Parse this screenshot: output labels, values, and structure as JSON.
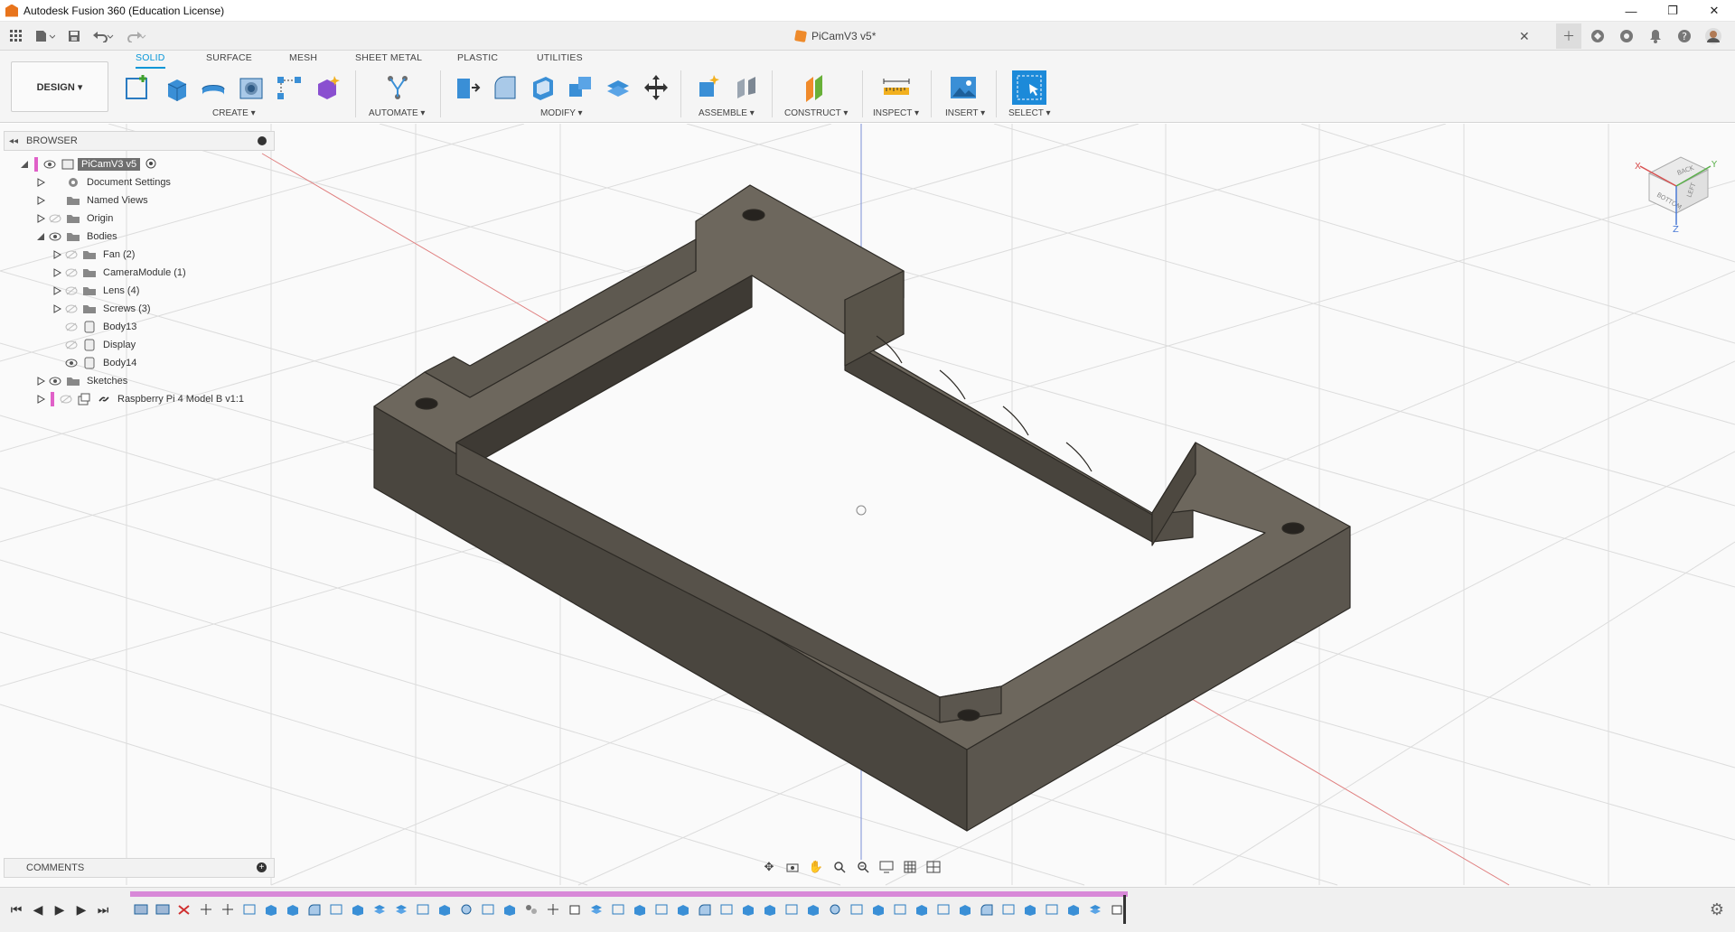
{
  "window": {
    "title": "Autodesk Fusion 360 (Education License)",
    "controls": [
      "—",
      "❐",
      "✕"
    ]
  },
  "tabrow": {
    "doc_title": "PiCamV3 v5*",
    "close": "✕"
  },
  "ribbon": {
    "workspace": "DESIGN ▾",
    "tabs": [
      "SOLID",
      "SURFACE",
      "MESH",
      "SHEET METAL",
      "PLASTIC",
      "UTILITIES"
    ],
    "groups": {
      "create": "CREATE ▾",
      "automate": "AUTOMATE ▾",
      "modify": "MODIFY ▾",
      "assemble": "ASSEMBLE ▾",
      "construct": "CONSTRUCT ▾",
      "inspect": "INSPECT ▾",
      "insert": "INSERT ▾",
      "select": "SELECT ▾"
    }
  },
  "browser": {
    "title": "BROWSER",
    "root": "PiCamV3 v5",
    "items": [
      {
        "label": "Document Settings",
        "icon": "gear-icon"
      },
      {
        "label": "Named Views",
        "icon": "folder-icon"
      },
      {
        "label": "Origin",
        "icon": "folder-icon"
      },
      {
        "label": "Bodies",
        "icon": "folder-icon"
      },
      {
        "label": "Fan (2)",
        "icon": "folder-icon"
      },
      {
        "label": "CameraModule (1)",
        "icon": "folder-icon"
      },
      {
        "label": "Lens (4)",
        "icon": "folder-icon"
      },
      {
        "label": "Screws (3)",
        "icon": "folder-icon"
      },
      {
        "label": "Body13",
        "icon": "body-icon"
      },
      {
        "label": "Display",
        "icon": "body-icon"
      },
      {
        "label": "Body14",
        "icon": "body-icon"
      },
      {
        "label": "Sketches",
        "icon": "folder-icon"
      },
      {
        "label": "Raspberry Pi 4 Model B v1:1",
        "icon": "link-icon"
      }
    ]
  },
  "viewcube": {
    "face_back": "BACK",
    "face_bottom": "BOTTOM",
    "face_left": "LEFT",
    "axis_x": "X",
    "axis_y": "Y",
    "axis_z": "Z"
  },
  "comments": {
    "title": "COMMENTS"
  },
  "colors": {
    "accent": "#0696d7",
    "model": "#5a554d",
    "timeline": "#d889d8"
  }
}
